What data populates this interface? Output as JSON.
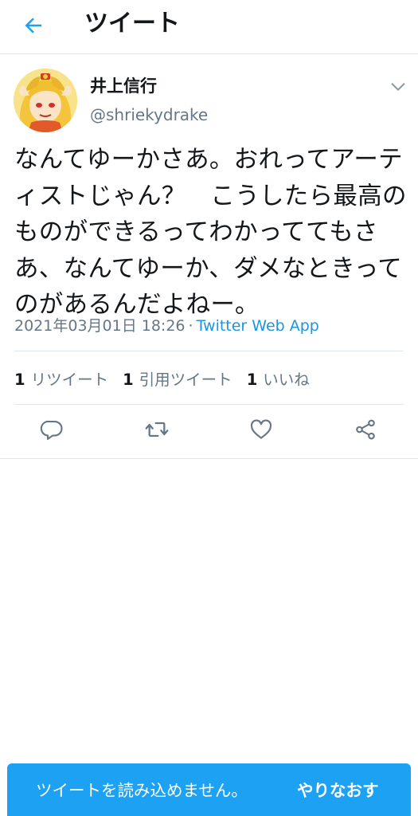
{
  "header": {
    "title": "ツイート"
  },
  "tweet": {
    "author_name": "井上信行",
    "author_handle": "@shriekydrake",
    "text": "なんてゆーかさあ。おれってアーティストじゃん？　こうしたら最高のものができるってわかっててもさあ、なんてゆーか、ダメなときってのがあるんだよねー。",
    "timestamp": "2021年03月01日 18:26",
    "separator": "·",
    "source": "Twitter Web App"
  },
  "stats": [
    {
      "count": "1",
      "label": "リツイート"
    },
    {
      "count": "1",
      "label": "引用ツイート"
    },
    {
      "count": "1",
      "label": "いいね"
    }
  ],
  "toast": {
    "message": "ツイートを読み込めません。",
    "action": "やりなおす"
  },
  "colors": {
    "accent": "#1da1f2",
    "link": "#1b95e0",
    "secondary_text": "#657786",
    "border": "#e1e8ed"
  },
  "icons": {
    "back": "arrow-left-icon",
    "caret": "chevron-down-icon",
    "reply": "reply-icon",
    "retweet": "retweet-icon",
    "like": "heart-icon",
    "share": "share-icon"
  }
}
